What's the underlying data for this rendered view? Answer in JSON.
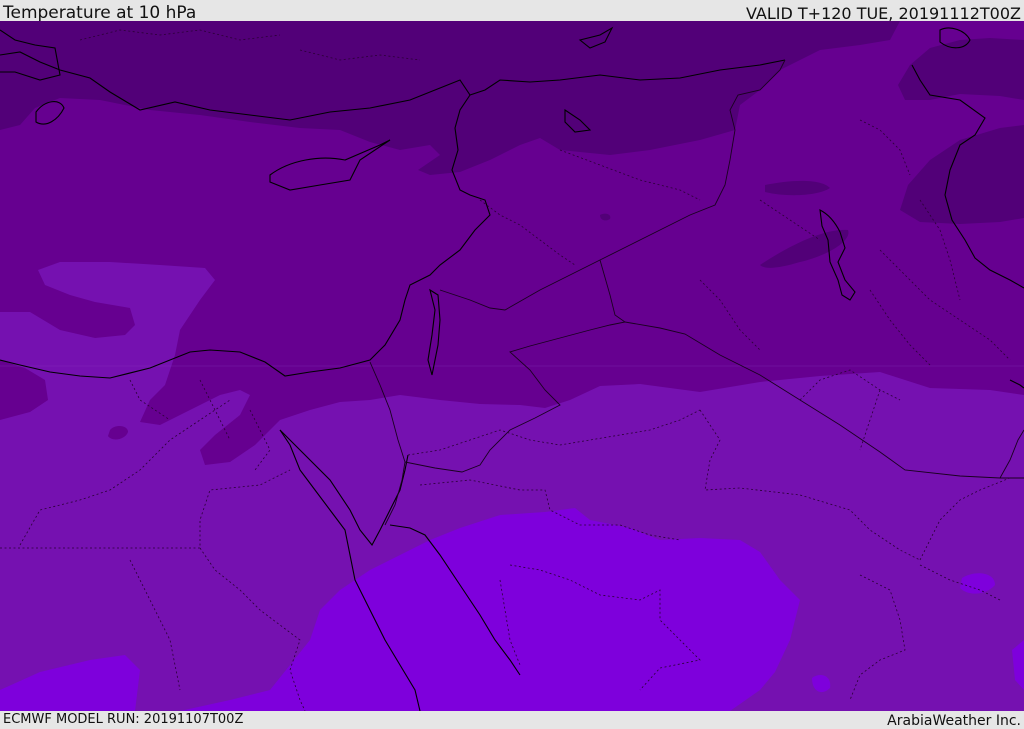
{
  "header": {
    "title": "Temperature at 10 hPa",
    "valid": "VALID T+120 TUE, 20191112T00Z"
  },
  "footer": {
    "model_run": "ECMWF MODEL RUN: 20191107T00Z",
    "credit": "ArabiaWeather Inc."
  },
  "colors": {
    "band_coldest": "#520078",
    "band_cold": "#660090",
    "band_mid": "#7511b0",
    "band_warm": "#7e00dc",
    "coastline": "#000000",
    "border": "#222222"
  }
}
